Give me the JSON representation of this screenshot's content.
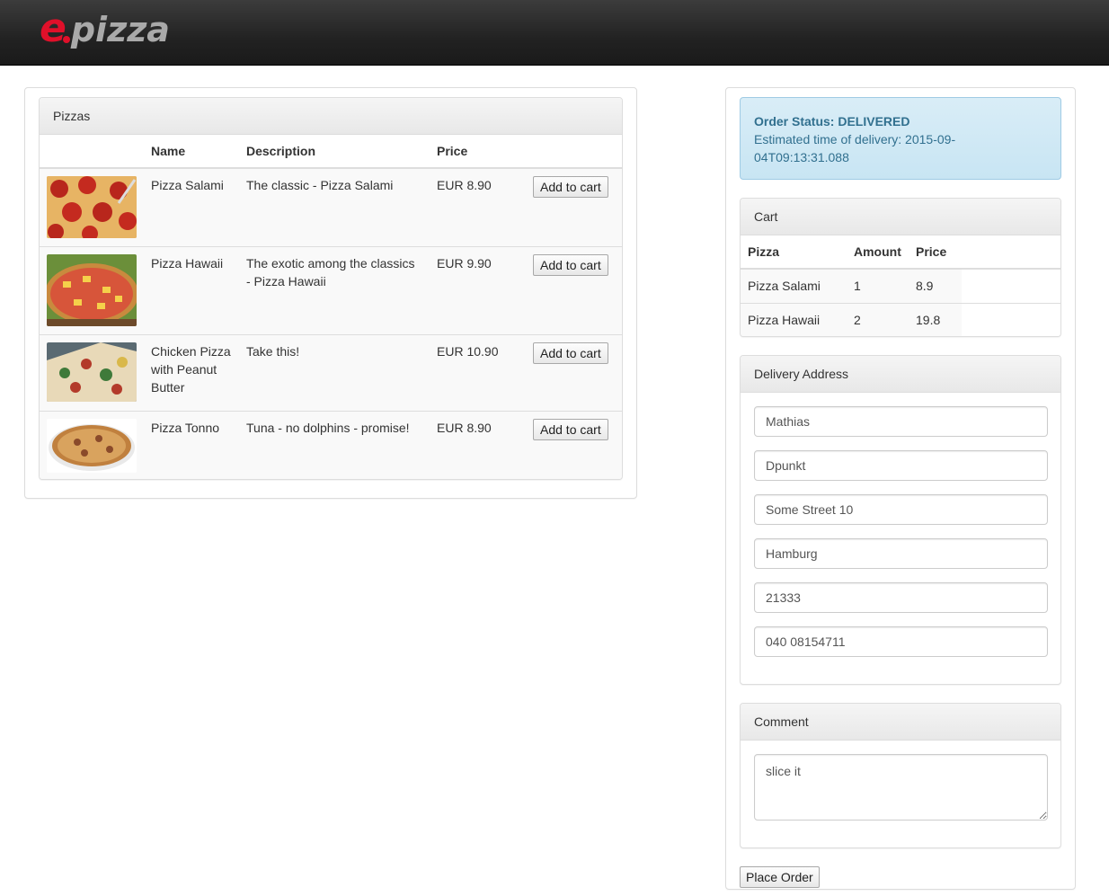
{
  "brand": {
    "logo_e": "e",
    "logo_text": "pizza"
  },
  "pizzas": {
    "heading": "Pizzas",
    "columns": [
      "",
      "Name",
      "Description",
      "Price"
    ],
    "add_label": "Add to cart",
    "rows": [
      {
        "name": "Pizza Salami",
        "description": "The classic - Pizza Salami",
        "price": "EUR 8.90",
        "image": "pizza-salami-photo"
      },
      {
        "name": "Pizza Hawaii",
        "description": "The exotic among the classics - Pizza Hawaii",
        "price": "EUR 9.90",
        "image": "pizza-hawaii-photo"
      },
      {
        "name": "Chicken Pizza with Peanut Butter",
        "description": "Take this!",
        "price": "EUR 10.90",
        "image": "chicken-pizza-photo"
      },
      {
        "name": "Pizza Tonno",
        "description": "Tuna - no dolphins - promise!",
        "price": "EUR 8.90",
        "image": "pizza-tonno-photo"
      }
    ]
  },
  "order_status": {
    "label": "Order Status: DELIVERED",
    "eta": "Estimated time of delivery: 2015-09-04T09:13:31.088"
  },
  "cart": {
    "heading": "Cart",
    "columns": [
      "Pizza",
      "Amount",
      "Price"
    ],
    "rows": [
      {
        "pizza": "Pizza Salami",
        "amount": "1",
        "price": "8.9"
      },
      {
        "pizza": "Pizza Hawaii",
        "amount": "2",
        "price": "19.8"
      }
    ]
  },
  "delivery": {
    "heading": "Delivery Address",
    "fields": {
      "name": "Mathias",
      "company": "Dpunkt",
      "street": "Some Street 10",
      "city": "Hamburg",
      "zip": "21333",
      "phone": "040 08154711"
    }
  },
  "comment": {
    "heading": "Comment",
    "value": "slice it"
  },
  "place_order_label": "Place Order",
  "colors": {
    "brand_red": "#e0102a",
    "logo_grey": "#a9a9a9",
    "alert_text": "#31708f",
    "alert_bg": "#d9edf7"
  }
}
